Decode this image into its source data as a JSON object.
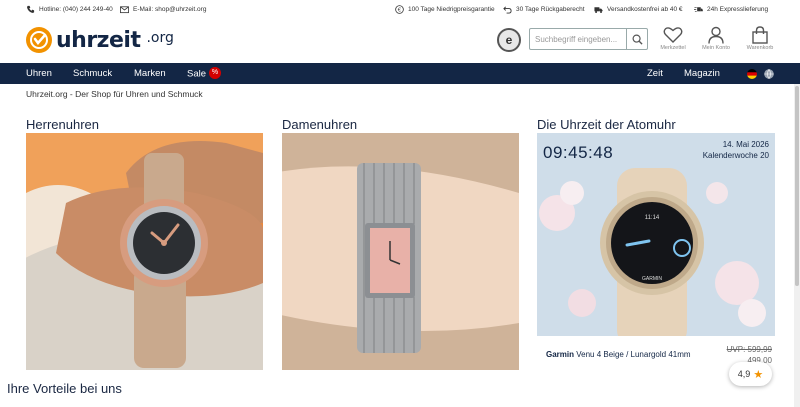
{
  "topbar": {
    "hotline": "Hotline: (040) 244 249-40",
    "email": "E-Mail: shop@uhrzeit.org",
    "guarantee": "100 Tage Niedrigpreisgarantie",
    "returns": "30 Tage Rückgaberecht",
    "shipping": "Versandkostenfrei ab 40 €",
    "express": "24h Expresslieferung"
  },
  "header": {
    "logo_main": "uhrzeit",
    "logo_suffix": ".org",
    "trust_badge": "e",
    "search_placeholder": "Suchbegriff eingeben...",
    "wishlist_label": "Merkzettel",
    "account_label": "Mein Konto",
    "cart_label": "Warenkorb"
  },
  "nav": {
    "items": [
      "Uhren",
      "Schmuck",
      "Marken",
      "Sale"
    ],
    "sale_badge": "%",
    "right_items": [
      "Zeit",
      "Magazin"
    ]
  },
  "breadcrumb": "Uhrzeit.org - Der Shop für Uhren und Schmuck",
  "sections": {
    "men": "Herrenuhren",
    "women": "Damenuhren",
    "atomic": "Die Uhrzeit der Atomuhr"
  },
  "atomic": {
    "time": "09:45:48",
    "date": "14. Mai 2026",
    "week": "Kalenderwoche 20",
    "watch_face_time": "11:14",
    "watch_brand_face": "GARMIN",
    "brand": "Garmin",
    "product": "Venu 4 Beige / Lunargold 41mm",
    "uvp": "UVP: 599,99",
    "price": "499,00"
  },
  "vorteile_title": "Ihre Vorteile bei uns",
  "rating": "4,9",
  "colors": {
    "navy": "#132645",
    "orange": "#f29200",
    "sale_red": "#d40000"
  }
}
